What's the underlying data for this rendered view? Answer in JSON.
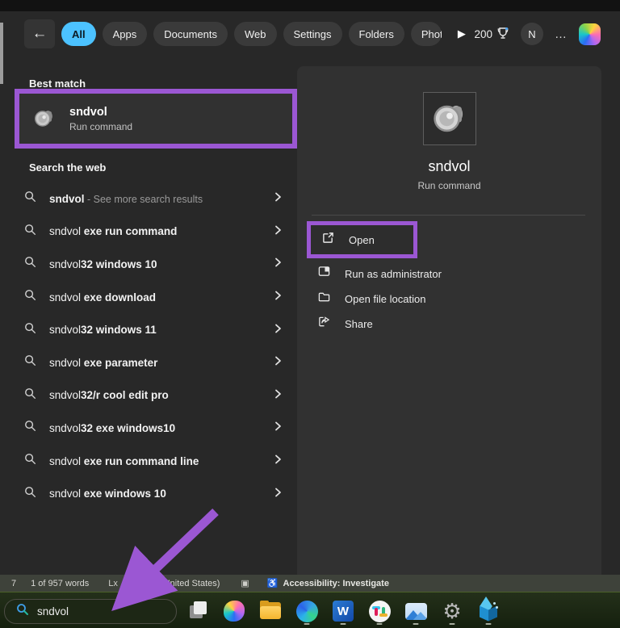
{
  "colors": {
    "highlight_purple": "#9b57d3",
    "accent_blue": "#4cc2ff"
  },
  "filter_bar": {
    "back_icon": "←",
    "tabs": [
      {
        "label": "All",
        "active": true
      },
      {
        "label": "Apps",
        "active": false
      },
      {
        "label": "Documents",
        "active": false
      },
      {
        "label": "Web",
        "active": false
      },
      {
        "label": "Settings",
        "active": false
      },
      {
        "label": "Folders",
        "active": false
      },
      {
        "label": "Phot",
        "active": false,
        "truncated": true
      }
    ],
    "more_arrow": "▶",
    "rewards_points": "200",
    "avatar_initial": "N",
    "overflow_label": "…"
  },
  "left_panel": {
    "best_match_heading": "Best match",
    "best_match": {
      "title": "sndvol",
      "subtitle": "Run command"
    },
    "web_heading": "Search the web",
    "web_results": [
      {
        "prefix": "sndvol",
        "suffix": " - See more search results",
        "first": true
      },
      {
        "prefix": "sndvol",
        "suffix": " exe run command"
      },
      {
        "prefix": "sndvol",
        "suffix": "32 windows 10"
      },
      {
        "prefix": "sndvol",
        "suffix": " exe download"
      },
      {
        "prefix": "sndvol",
        "suffix": "32 windows 11"
      },
      {
        "prefix": "sndvol",
        "suffix": " exe parameter"
      },
      {
        "prefix": "sndvol",
        "suffix": "32/r cool edit pro"
      },
      {
        "prefix": "sndvol",
        "suffix": "32 exe windows10"
      },
      {
        "prefix": "sndvol",
        "suffix": " exe run command line"
      },
      {
        "prefix": "sndvol",
        "suffix": " exe windows 10"
      }
    ]
  },
  "detail_panel": {
    "title": "sndvol",
    "subtitle": "Run command",
    "actions": [
      {
        "label": "Open",
        "icon": "open-external-icon",
        "highlighted": true
      },
      {
        "label": "Run as administrator",
        "icon": "admin-shield-icon"
      },
      {
        "label": "Open file location",
        "icon": "folder-icon"
      },
      {
        "label": "Share",
        "icon": "share-icon"
      }
    ]
  },
  "status_bar": {
    "page_fragment": "7",
    "word_count": "1 of 957 words",
    "proofing_icon_label": "Lx",
    "language": "English (United States)",
    "focus_icon_label": "▣",
    "accessibility_icon_label": "♿",
    "accessibility": "Accessibility: Investigate"
  },
  "taskbar": {
    "search_value": "sndvol",
    "icons": [
      "task-view",
      "copilot",
      "file-explorer",
      "edge",
      "word",
      "slack",
      "photos",
      "settings",
      "paint-3d"
    ],
    "running": [
      "edge",
      "word",
      "slack",
      "photos",
      "settings",
      "paint-3d"
    ]
  }
}
